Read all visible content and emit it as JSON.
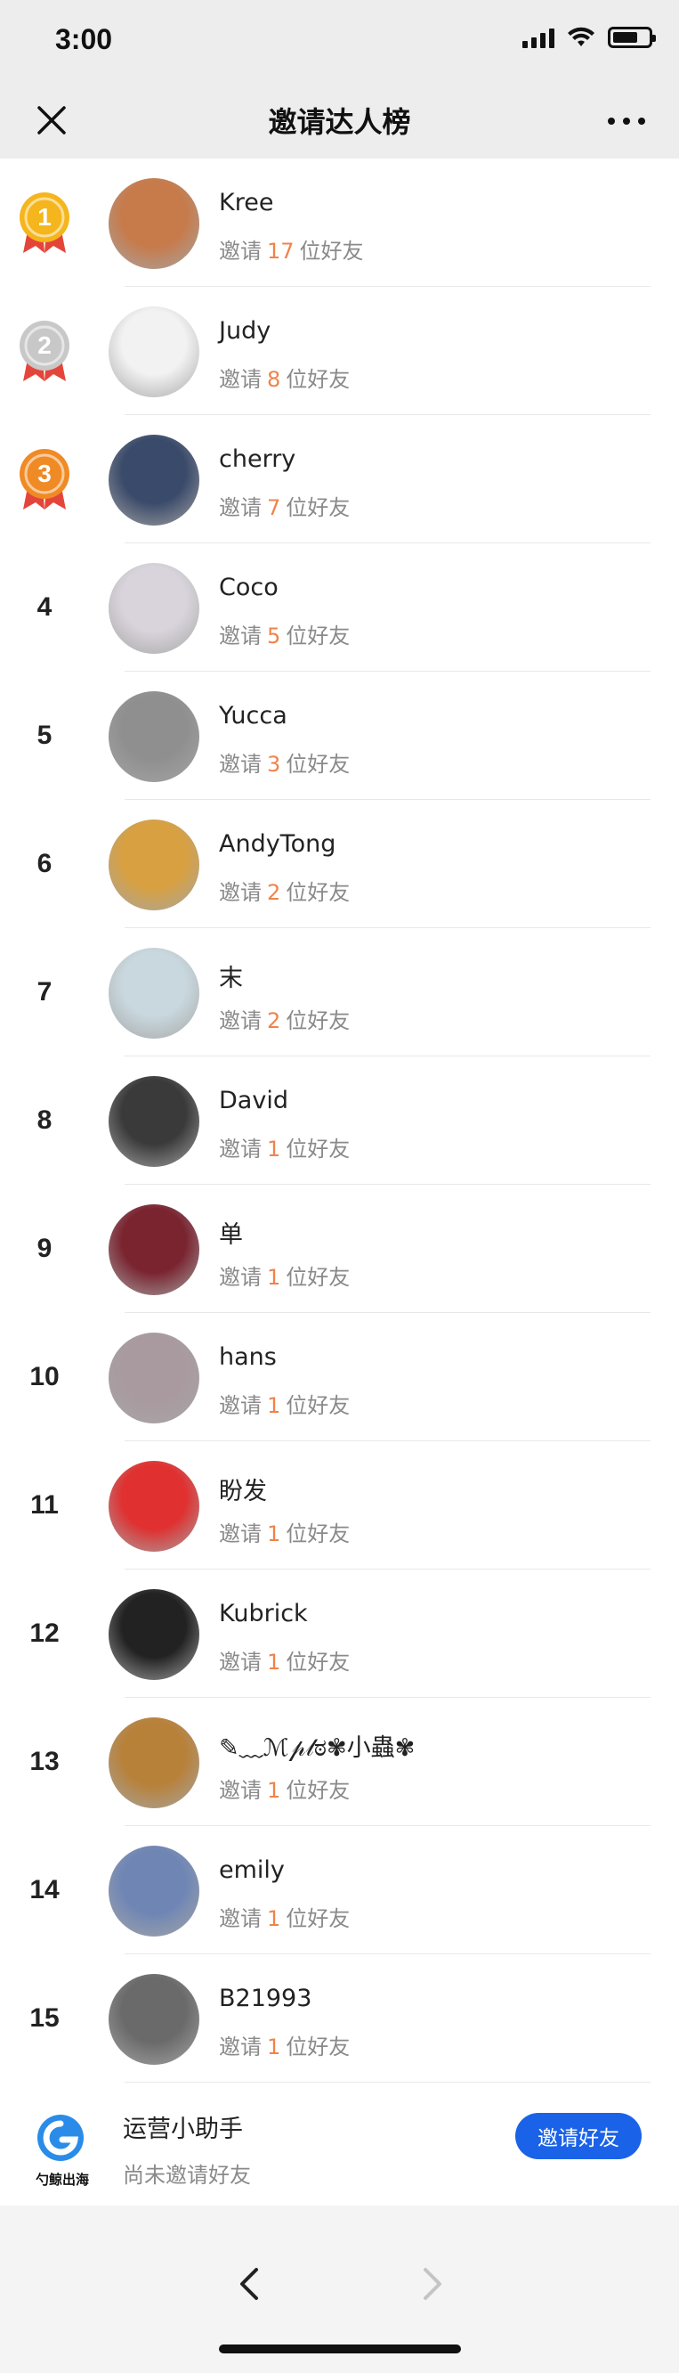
{
  "status_bar": {
    "time": "3:00"
  },
  "nav": {
    "title": "邀请达人榜"
  },
  "invite_prefix": "邀请",
  "invite_suffix": "位好友",
  "rows": [
    {
      "rank": "1",
      "name": "Kree",
      "count": "17",
      "medal": "gold"
    },
    {
      "rank": "2",
      "name": "Judy",
      "count": "8",
      "medal": "silver"
    },
    {
      "rank": "3",
      "name": "cherry",
      "count": "7",
      "medal": "bronze"
    },
    {
      "rank": "4",
      "name": "Coco",
      "count": "5"
    },
    {
      "rank": "5",
      "name": "Yucca",
      "count": "3"
    },
    {
      "rank": "6",
      "name": "AndyTong",
      "count": "2"
    },
    {
      "rank": "7",
      "name": "末",
      "count": "2"
    },
    {
      "rank": "8",
      "name": "David",
      "count": "1"
    },
    {
      "rank": "9",
      "name": "单",
      "count": "1"
    },
    {
      "rank": "10",
      "name": "hans",
      "count": "1"
    },
    {
      "rank": "11",
      "name": "盼发",
      "count": "1"
    },
    {
      "rank": "12",
      "name": "Kubrick",
      "count": "1"
    },
    {
      "rank": "13",
      "name": "✎﹏ℳ𝓅𝓁ಠ✾小蟲✾",
      "count": "1"
    },
    {
      "rank": "14",
      "name": "emily",
      "count": "1"
    },
    {
      "rank": "15",
      "name": "B21993",
      "count": "1"
    }
  ],
  "assistant": {
    "name": "运营小助手",
    "desc": "尚未邀请好友",
    "button": "邀请好友",
    "logo_text": "勺鲸出海"
  },
  "colors": {
    "accent_button": "#1a63e8",
    "count": "#f0834a",
    "gold": "#f5b51c",
    "silver": "#c8c8c8",
    "bronze": "#f08a24"
  },
  "avatar_colors": [
    "#c77a4a",
    "#f2f2f2",
    "#3a4a6a",
    "#d9d4dc",
    "#8f8f8f",
    "#d8a040",
    "#c9d8de",
    "#3a3a3a",
    "#7a2430",
    "#a99aa0",
    "#e03030",
    "#222222",
    "#b8813a",
    "#6f86b5",
    "#6a6a6a"
  ]
}
